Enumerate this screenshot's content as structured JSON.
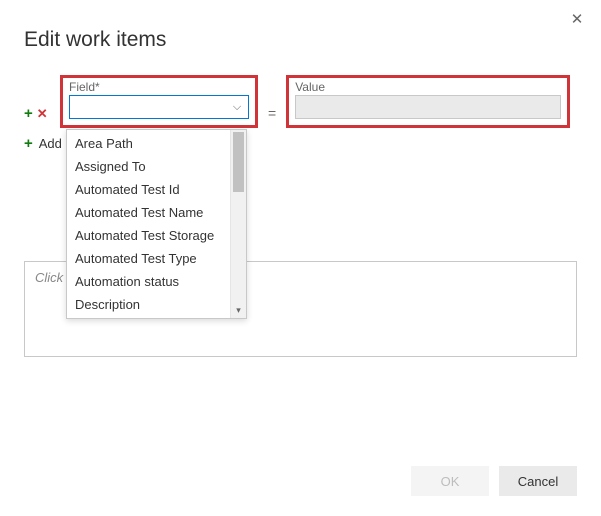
{
  "dialog": {
    "title": "Edit work items",
    "close_glyph": "✕"
  },
  "row": {
    "field_label": "Field*",
    "value_label": "Value",
    "field_value": "",
    "equals": "=",
    "add_glyph": "+",
    "remove_glyph": "✕",
    "caret_glyph": "⌵"
  },
  "add_row": {
    "glyph": "+",
    "label": "Add new clause"
  },
  "dropdown": {
    "items": [
      "Area Path",
      "Assigned To",
      "Automated Test Id",
      "Automated Test Name",
      "Automated Test Storage",
      "Automated Test Type",
      "Automation status",
      "Description"
    ],
    "scroll_down_glyph": "▾"
  },
  "notes": {
    "placeholder": "Click to add notes"
  },
  "footer": {
    "ok": "OK",
    "cancel": "Cancel"
  }
}
